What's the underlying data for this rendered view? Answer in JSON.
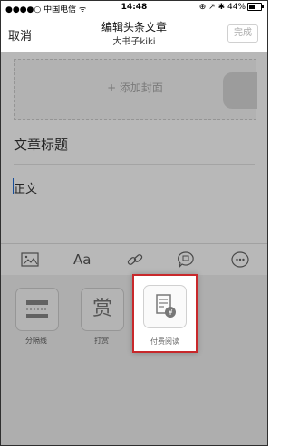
{
  "status_bar": {
    "carrier": "●●●●○ 中国电信 ᯤ",
    "time": "14:48",
    "right": "⊕ ↗ ✱ 44%"
  },
  "nav": {
    "cancel_label": "取消",
    "title": "编辑头条文章",
    "subtitle": "大书子kiki",
    "done_label": "完成"
  },
  "cover": {
    "label": "+ 添加封面"
  },
  "editor": {
    "title_placeholder": "文章标题",
    "body_placeholder": "正文"
  },
  "toolbar": {
    "font_label": "Aa",
    "icons": [
      "image-icon",
      "font-icon",
      "link-icon",
      "voice-bubble-icon",
      "emoji-bubble-icon"
    ]
  },
  "panel": {
    "items": [
      {
        "label": "分隔线",
        "icon": "divider-icon",
        "glyph": ""
      },
      {
        "label": "打赏",
        "icon": "reward-icon",
        "glyph": "赏"
      },
      {
        "label": "付费阅读",
        "icon": "paid-reading-icon",
        "glyph": ""
      }
    ]
  },
  "colors": {
    "highlight": "#c8282b",
    "caret": "#1e6bd6"
  }
}
